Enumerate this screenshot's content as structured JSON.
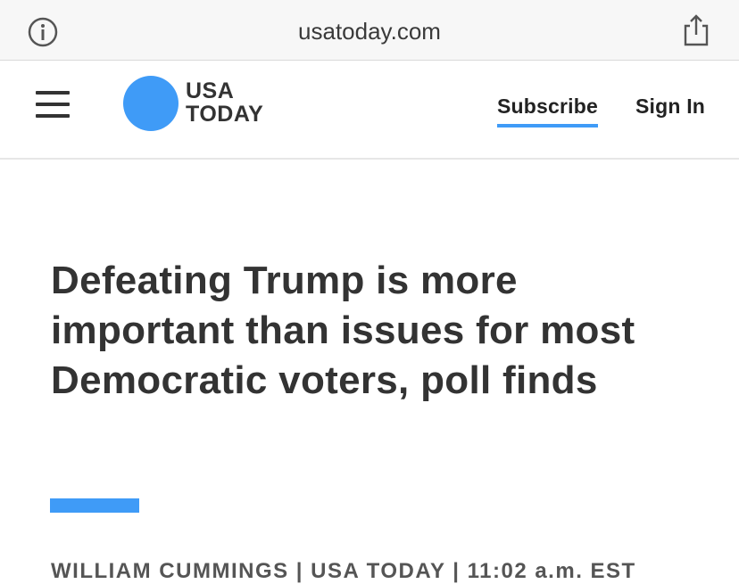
{
  "browser": {
    "url": "usatoday.com",
    "info_icon": "info-icon",
    "share_icon": "share-icon"
  },
  "header": {
    "menu_icon": "hamburger-menu-icon",
    "logo": {
      "line1": "USA",
      "line2": "TODAY",
      "circle_color": "#3f9bf7"
    },
    "subscribe_label": "Subscribe",
    "signin_label": "Sign In"
  },
  "article": {
    "headline": "Defeating Trump is more important than issues for most Democratic voters, poll finds",
    "accent_color": "#3f9bf7",
    "byline": "WILLIAM CUMMINGS | USA TODAY | 11:02 a.m. EST"
  }
}
